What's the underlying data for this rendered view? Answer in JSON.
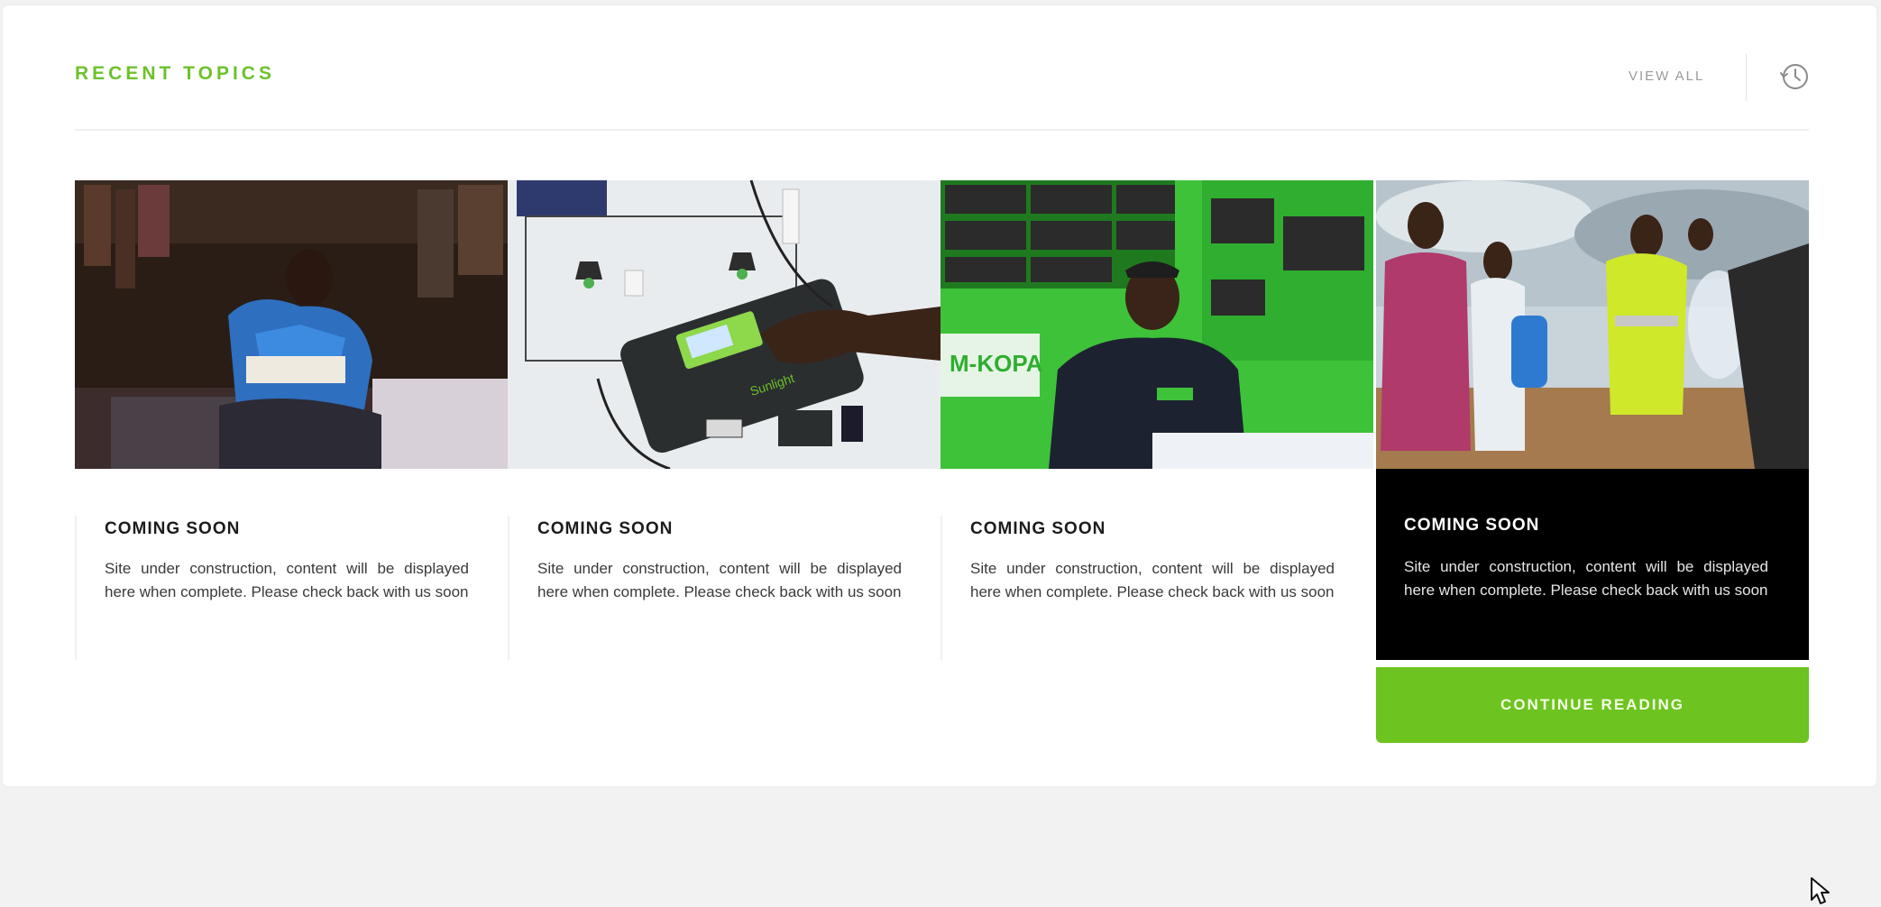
{
  "header": {
    "title": "RECENT TOPICS",
    "view_all_label": "VIEW ALL",
    "history_icon": "history-clock-icon"
  },
  "accent_color": "#6cc22b",
  "cards": [
    {
      "image": "person-reading-by-solar-lamp-photo",
      "title": "COMING SOON",
      "text": "Site under construction, content will be displayed here when complete. Please check back with us soon"
    },
    {
      "image": "solar-battery-unit-on-wall-photo",
      "title": "COMING SOON",
      "text": "Site under construction, content will be displayed here when complete. Please check back with us soon"
    },
    {
      "image": "smiling-agent-in-green-shop-photo",
      "image_sign_text": "M-KOPA",
      "title": "COMING SOON",
      "text": "Site under construction, content will be displayed here when complete. Please check back with us soon"
    },
    {
      "image": "people-outdoors-with-solar-lamp-photo",
      "title": "COMING SOON",
      "text": "Site under construction, content will be displayed here when complete. Please check back with us soon",
      "button_label": "CONTINUE READING"
    }
  ],
  "cursor_icon": "mouse-pointer-icon"
}
